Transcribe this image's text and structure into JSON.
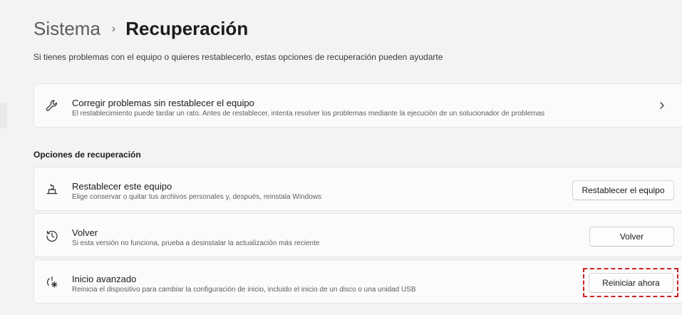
{
  "header": {
    "parent": "Sistema",
    "separator": "›",
    "current": "Recuperación"
  },
  "subtitle": "Si tienes problemas con el equipo o quieres restablecerlo, estas opciones de recuperación pueden ayudarte",
  "troubleshoot": {
    "icon": "wrench-icon",
    "title": "Corregir problemas sin restablecer el equipo",
    "description": "El restablecimiento puede tardar un rato. Antes de restablecer, intenta resolver los problemas mediante la ejecución de un solucionador de problemas"
  },
  "section_header": "Opciones de recuperación",
  "options": [
    {
      "icon": "reset-pc-icon",
      "title": "Restablecer este equipo",
      "description": "Elige conservar o quitar tus archivos personales y, después, reinstala Windows",
      "button": "Restablecer el equipo"
    },
    {
      "icon": "history-icon",
      "title": "Volver",
      "description": "Si esta versión no funciona, prueba a desinstalar la actualización más reciente",
      "button": "Volver"
    },
    {
      "icon": "advanced-startup-icon",
      "title": "Inicio avanzado",
      "description": "Reinicia el dispositivo para cambiar la configuración de inicio, incluido el inicio de un disco o una unidad USB",
      "button": "Reiniciar ahora"
    }
  ],
  "colors": {
    "background": "#f3f3f3",
    "card": "#fbfbfb",
    "highlight": "#cc2222"
  }
}
